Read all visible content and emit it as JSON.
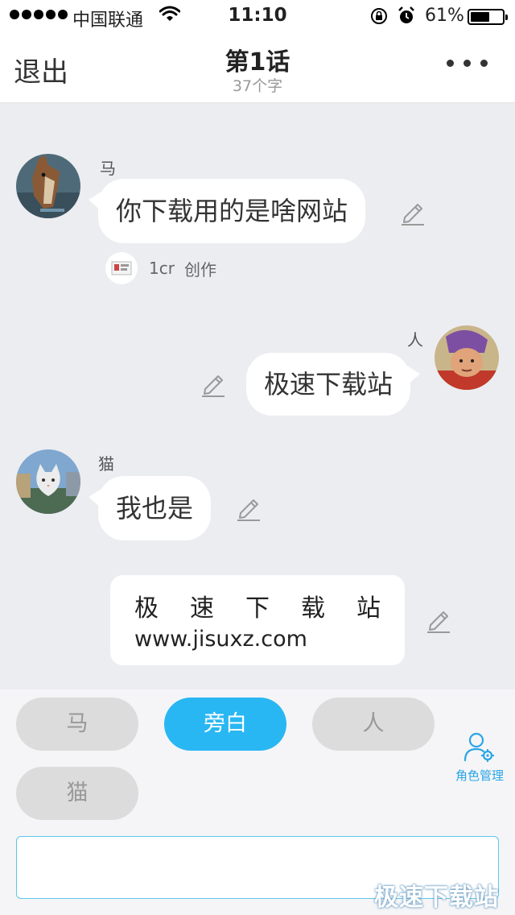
{
  "status_bar": {
    "carrier": "中国联通",
    "time": "11:10",
    "battery_percent": "61%",
    "battery_level": 0.61
  },
  "nav": {
    "back_label": "退出",
    "title": "第1话",
    "subtitle": "37个字",
    "more_icon": "more-dots-icon"
  },
  "messages": [
    {
      "speaker": "马",
      "text": "你下载用的是啥网站",
      "side": "left",
      "avatar": "horse-avatar"
    },
    {
      "speaker": "人",
      "text": "极速下载站",
      "side": "right",
      "avatar": "person-avatar"
    },
    {
      "speaker": "猫",
      "text": "我也是",
      "side": "left",
      "avatar": "cat-avatar"
    }
  ],
  "author": {
    "name": "1cr",
    "role": "创作"
  },
  "narration": {
    "line1": "极速下载站",
    "line2": "www.jisuxz.com"
  },
  "roles": [
    {
      "label": "马",
      "active": false
    },
    {
      "label": "旁白",
      "active": true
    },
    {
      "label": "人",
      "active": false
    },
    {
      "label": "猫",
      "active": false
    }
  ],
  "role_manage_label": "角色管理",
  "input": {
    "value": "",
    "placeholder": ""
  },
  "watermark": "极速下载站",
  "colors": {
    "accent": "#28b7f3",
    "background": "#ecedf1",
    "bubble": "#ffffff",
    "chip_inactive": "#dcdcdc"
  }
}
